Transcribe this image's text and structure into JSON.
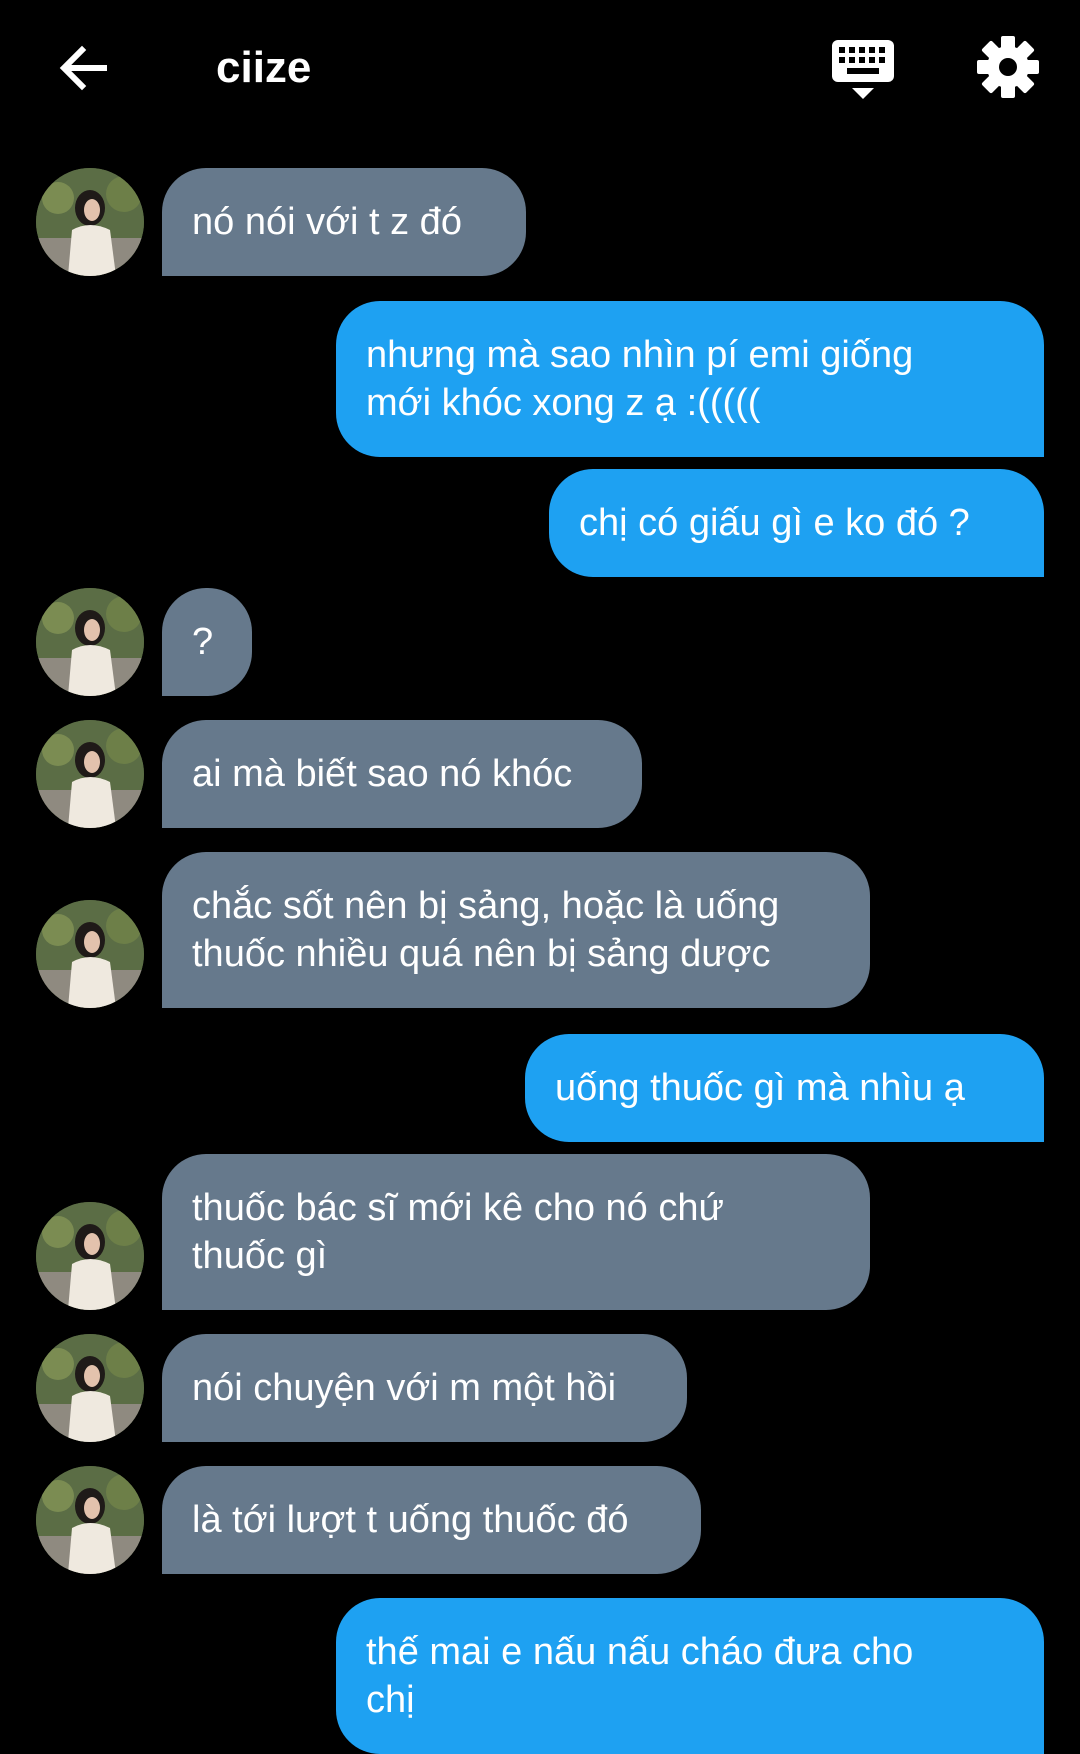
{
  "header": {
    "title": "ciize",
    "back_icon": "arrow-left-icon",
    "keyboard_icon": "keyboard-icon",
    "settings_icon": "gear-icon"
  },
  "colors": {
    "background": "#000000",
    "incoming_bubble": "#66798c",
    "outgoing_bubble": "#1ea1f2",
    "text": "#ffffff"
  },
  "messages": [
    {
      "sender": "them",
      "text": "nó nói với t z đó"
    },
    {
      "sender": "me",
      "text": "nhưng mà sao nhìn pí emi giống\nmới khóc xong z ạ :((((("
    },
    {
      "sender": "me",
      "text": "chị có giấu gì e ko đó ?"
    },
    {
      "sender": "them",
      "text": "?"
    },
    {
      "sender": "them",
      "text": "ai mà biết sao nó khóc"
    },
    {
      "sender": "them",
      "text": "chắc sốt nên bị sảng, hoặc là uống\nthuốc nhiều quá nên bị sảng dược"
    },
    {
      "sender": "me",
      "text": "uống thuốc gì mà nhìu ạ"
    },
    {
      "sender": "them",
      "text": "thuốc bác sĩ mới kê cho nó chứ\nthuốc gì"
    },
    {
      "sender": "them",
      "text": "nói chuyện với m một hồi"
    },
    {
      "sender": "them",
      "text": "là tới lượt t uống thuốc đó"
    },
    {
      "sender": "me",
      "text": "thế mai e nấu nấu cháo đưa cho\nchị"
    }
  ]
}
